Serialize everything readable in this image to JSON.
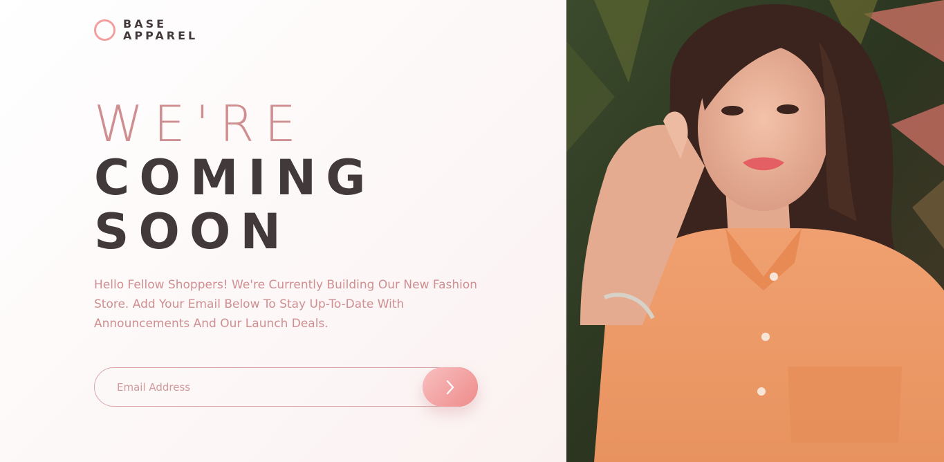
{
  "brand": {
    "line1": "BASE",
    "line2": "APPAREL",
    "accent": "#f29f9f"
  },
  "hero": {
    "line1": "WE'RE",
    "line2": "COMING",
    "line3": "SOON"
  },
  "description": "Hello Fellow Shoppers! We're Currently Building Our New Fashion Store. Add Your Email Below To Stay Up-To-Date With Announcements And Our Launch Deals.",
  "form": {
    "email_placeholder": "Email Address",
    "email_value": "",
    "submit_icon": "chevron-right-icon"
  },
  "colors": {
    "heading_dark": "#423a3a",
    "text_pink": "#cf8f91",
    "button_gradient_start": "#f8bfbf",
    "button_gradient_end": "#ee8b8b"
  },
  "image": {
    "subject": "hero-photo-woman-orange-shirt"
  }
}
